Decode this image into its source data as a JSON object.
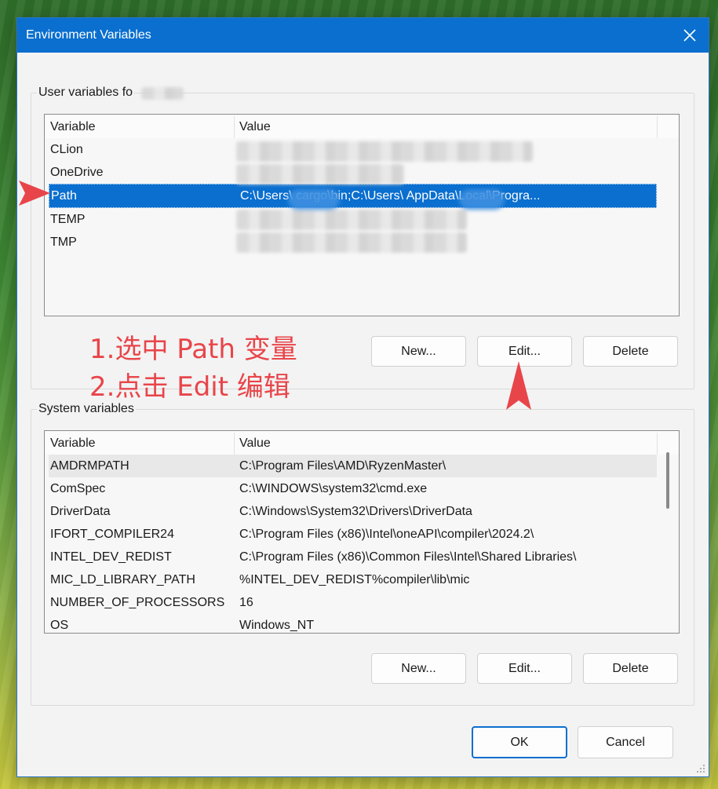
{
  "window": {
    "title": "Environment Variables"
  },
  "user_vars": {
    "label": "User variables fo",
    "header": {
      "variable": "Variable",
      "value": "Value"
    },
    "rows": [
      {
        "variable": "CLion",
        "value": ""
      },
      {
        "variable": "OneDrive",
        "value": ""
      },
      {
        "variable": "Path",
        "value": "C:\\Users\\          cargo\\bin;C:\\Users\\          AppData\\Local\\Progra..."
      },
      {
        "variable": "TEMP",
        "value": ""
      },
      {
        "variable": "TMP",
        "value": ""
      }
    ],
    "buttons": {
      "new": "New...",
      "edit": "Edit...",
      "delete": "Delete"
    }
  },
  "system_vars": {
    "label": "System variables",
    "header": {
      "variable": "Variable",
      "value": "Value"
    },
    "rows": [
      {
        "variable": "AMDRMPATH",
        "value": "C:\\Program Files\\AMD\\RyzenMaster\\"
      },
      {
        "variable": "ComSpec",
        "value": "C:\\WINDOWS\\system32\\cmd.exe"
      },
      {
        "variable": "DriverData",
        "value": "C:\\Windows\\System32\\Drivers\\DriverData"
      },
      {
        "variable": "IFORT_COMPILER24",
        "value": "C:\\Program Files (x86)\\Intel\\oneAPI\\compiler\\2024.2\\"
      },
      {
        "variable": "INTEL_DEV_REDIST",
        "value": "C:\\Program Files (x86)\\Common Files\\Intel\\Shared Libraries\\"
      },
      {
        "variable": "MIC_LD_LIBRARY_PATH",
        "value": "%INTEL_DEV_REDIST%compiler\\lib\\mic"
      },
      {
        "variable": "NUMBER_OF_PROCESSORS",
        "value": "16"
      },
      {
        "variable": "OS",
        "value": "Windows_NT"
      }
    ],
    "buttons": {
      "new": "New...",
      "edit": "Edit...",
      "delete": "Delete"
    }
  },
  "dialog_buttons": {
    "ok": "OK",
    "cancel": "Cancel"
  },
  "annotation": {
    "line1": "1.选中 Path 变量",
    "line2": "2.点击 Edit 编辑"
  },
  "colors": {
    "accent": "#0a6fcf",
    "annotation": "#e8454a"
  }
}
